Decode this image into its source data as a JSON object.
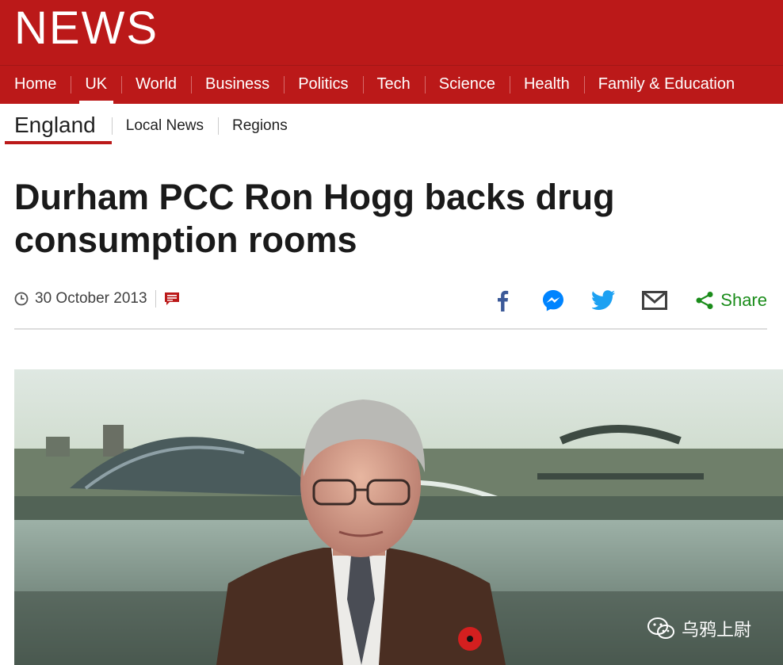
{
  "header": {
    "logo": "NEWS",
    "nav": [
      "Home",
      "UK",
      "World",
      "Business",
      "Politics",
      "Tech",
      "Science",
      "Health",
      "Family & Education"
    ],
    "active_nav": "UK"
  },
  "subnav": {
    "section": "England",
    "items": [
      "Local News",
      "Regions"
    ]
  },
  "article": {
    "headline": "Durham PCC Ron Hogg backs drug consumption rooms",
    "date": "30 October 2013",
    "share_label": "Share"
  },
  "share_icons": [
    "facebook-icon",
    "messenger-icon",
    "twitter-icon",
    "email-icon",
    "share-icon"
  ],
  "colors": {
    "brand_red": "#bb1919",
    "share_green": "#1a8c1a",
    "facebook_blue": "#3b5998",
    "messenger_blue": "#0084ff",
    "twitter_blue": "#1da1f2"
  },
  "watermark": {
    "text": "乌鸦上尉"
  }
}
